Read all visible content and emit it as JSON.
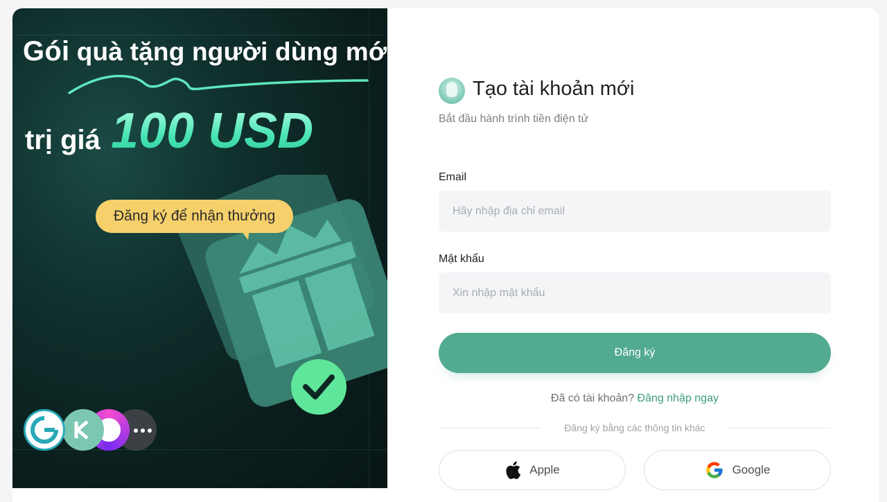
{
  "promo": {
    "title_line1_a": "Gói",
    "title_line1_b": "quà tặng người dùng mới",
    "title_line2": "trị giá",
    "amount": "100 USD",
    "bubble": "Đăng ký để nhận thưởng",
    "logos": [
      "coinbase-logo",
      "kraken-logo",
      "purple-wallet-logo",
      "more-icon"
    ],
    "colors": {
      "accent": "#4ee6b7",
      "bubble": "#f5d06b",
      "bg": "#0f2f2c"
    }
  },
  "form": {
    "title": "Tạo tài khoản mới",
    "subtitle": "Bắt đầu hành trình tiền điện tử",
    "email_label": "Email",
    "email_placeholder": "Hãy nhập địa chỉ email",
    "password_label": "Mật khẩu",
    "password_placeholder": "Xin nhập mật khẩu",
    "submit_label": "Đăng ký",
    "have_account": "Đã có tài khoản?",
    "login_link": "Đăng nhập ngay",
    "other_methods": "Đăng ký bằng các thông tin khác",
    "apple_label": "Apple",
    "google_label": "Google",
    "colors": {
      "primary": "#52aa91",
      "link": "#3e9c82"
    }
  }
}
